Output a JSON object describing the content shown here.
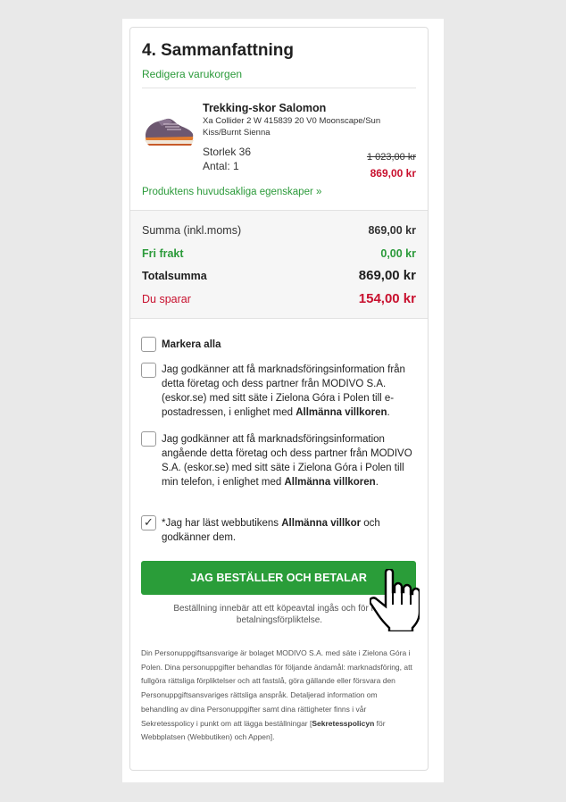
{
  "summary_section": {
    "title": "4. Sammanfattning",
    "edit_cart_link": "Redigera varukorgen"
  },
  "product": {
    "name": "Trekking-skor Salomon",
    "description": "Xa Collider 2 W 415839 20 V0 Moonscape/Sun Kiss/Burnt Sienna",
    "size": "Storlek 36",
    "quantity": "Antal: 1",
    "old_price": "1 023,00 kr",
    "new_price": "869,00 kr",
    "features_link": "Produktens huvudsakliga egenskaper »",
    "image_icon": "shoe-image"
  },
  "totals": {
    "subtotal_label": "Summa (inkl.moms)",
    "subtotal_value": "869,00 kr",
    "shipping_label": "Fri frakt",
    "shipping_value": "0,00 kr",
    "total_label": "Totalsumma",
    "total_value": "869,00 kr",
    "savings_label": "Du sparar",
    "savings_value": "154,00 kr"
  },
  "consents": {
    "select_all": "Markera alla",
    "email_consent_pre": "Jag godkänner att få marknadsföringsinformation från detta företag och dess partner från MODIVO S.A. (eskor.se) med sitt säte i Zielona Góra i Polen till e-postadressen, i enlighet med ",
    "email_consent_bold": "Allmänna villkoren",
    "email_consent_post": ".",
    "phone_consent_pre": "Jag godkänner att få marknadsföringsinformation angående detta företag och dess partner från MODIVO S.A. (eskor.se) med sitt säte i Zielona Góra i Polen till min telefon, i enlighet med ",
    "phone_consent_bold": "Allmänna villkoren",
    "phone_consent_post": ".",
    "terms_pre": "*Jag har läst webbutikens ",
    "terms_bold": "Allmänna villkor",
    "terms_post": " och godkänner dem.",
    "terms_checked": true
  },
  "order": {
    "button_label": "JAG BESTÄLLER OCH BETALAR",
    "note": "Beställning innebär att ett köpeavtal ingås och för mig betalningsförpliktelse."
  },
  "legal": {
    "text_pre": "Din Personuppgiftsansvarige är bolaget MODIVO S.A. med säte i Zielona Góra i Polen. Dina personuppgifter behandlas för följande ändamål: marknadsföring, att fullgöra rättsliga förpliktelser och att fastslå, göra gällande eller försvara den Personuppgiftsansvariges rättsliga anspråk. Detaljerad information om behandling av dina Personuppgifter samt dina rättigheter finns i vår Sekretesspolicy i punkt om att lägga beställningar [",
    "text_bold": "Sekretesspolicyn",
    "text_post": " för Webbplatsen (Webbutiken) och Appen]."
  },
  "colors": {
    "accent_green": "#2a9d39",
    "link_green": "#2b9a3a",
    "sale_red": "#c8102e",
    "background": "#e9e9e9"
  }
}
